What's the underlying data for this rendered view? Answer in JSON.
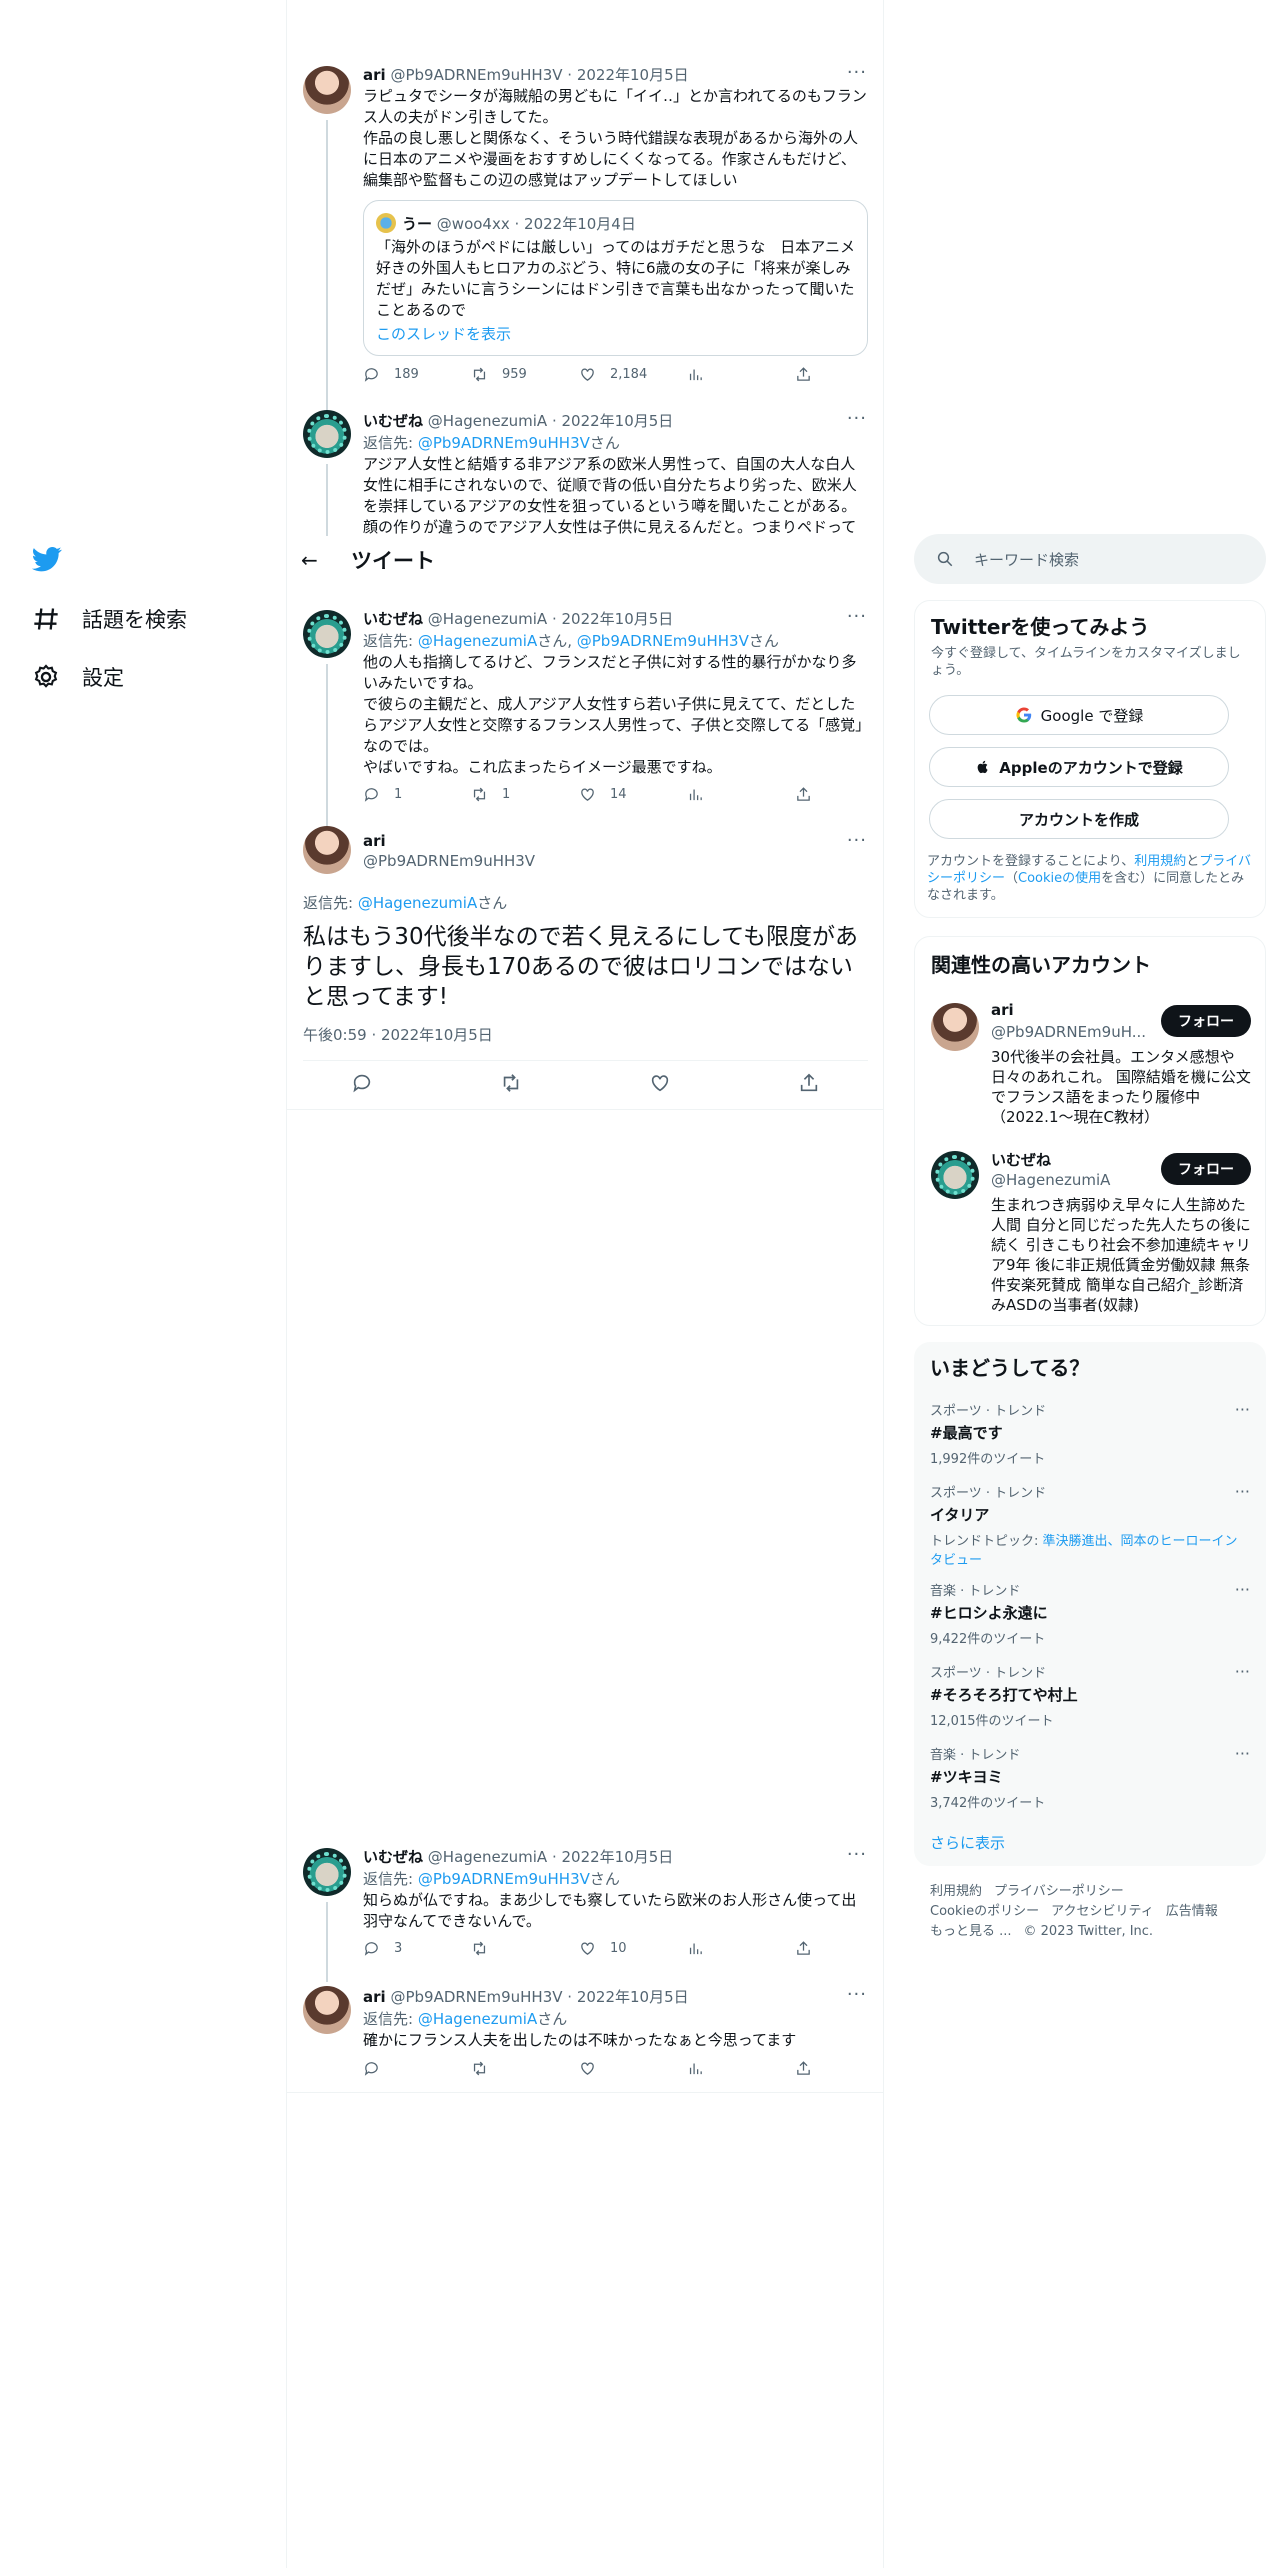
{
  "nav": {
    "explore_label": "話題を検索",
    "settings_label": "設定"
  },
  "header": {
    "back_arrow": "←",
    "title": "ツイート"
  },
  "tweets": {
    "t1": {
      "name": "ari",
      "handle_date": "@Pb9ADRNEm9uHH3V · 2022年10月5日",
      "text": "ラピュタでシータが海賊船の男どもに「イイ‥」とか言われてるのもフランス人の夫がドン引きしてた。\n作品の良し悪しと関係なく、そういう時代錯誤な表現があるから海外の人に日本のアニメや漫画をおすすめしにくくなってる。作家さんもだけど、編集部や監督もこの辺の感覚はアップデートしてほしい",
      "quote": {
        "name": "うー",
        "handle_date": "@woo4xx · 2022年10月4日",
        "text": "「海外のほうがペドには厳しい」ってのはガチだと思うな　日本アニメ好きの外国人もヒロアカのぶどう、特に6歳の女の子に「将来が楽しみだぜ」みたいに言うシーンにはドン引きで言葉も出なかったって聞いたことあるので",
        "show_thread": "このスレッドを表示"
      },
      "replies": "189",
      "retweets": "959",
      "likes": "2,184"
    },
    "t2": {
      "name": "いむぜね",
      "handle_date": "@HagenezumiA · 2022年10月5日",
      "reply_prefix": "返信先: ",
      "reply_link": "@Pb9ADRNEm9uHH3V",
      "reply_suffix": "さん",
      "text": "アジア人女性と結婚する非アジア系の欧米人男性って、自国の大人な白人女性に相手にされないので、従順で背の低い自分たちより劣った、欧米人を崇拝しているアジアの女性を狙っているという噂を聞いたことがある。顔の作りが違うのでアジア人女性は子供に見えるんだと。つまりペドって"
    },
    "t3": {
      "name": "いむぜね",
      "handle_date": "@HagenezumiA · 2022年10月5日",
      "reply_prefix": "返信先: ",
      "reply_link1": "@HagenezumiA",
      "reply_mid": "さん, ",
      "reply_link2": "@Pb9ADRNEm9uHH3V",
      "reply_suffix": "さん",
      "text": "他の人も指摘してるけど、フランスだと子供に対する性的暴行がかなり多いみたいですね。\nで彼らの主観だと、成人アジア人女性すら若い子供に見えてて、だとしたらアジア人女性と交際するフランス人男性って、子供と交際してる「感覚」なのでは。\nやばいですね。これ広まったらイメージ最悪ですね。",
      "replies": "1",
      "retweets": "1",
      "likes": "14"
    },
    "focus": {
      "name": "ari",
      "handle": "@Pb9ADRNEm9uHH3V",
      "reply_prefix": "返信先: ",
      "reply_link": "@HagenezumiA",
      "reply_suffix": "さん",
      "text": "私はもう30代後半なので若く見えるにしても限度がありますし、身長も170あるので彼はロリコンではないと思ってます!",
      "timestamp": "午後0:59 · 2022年10月5日"
    },
    "t5": {
      "name": "いむぜね",
      "handle_date": "@HagenezumiA · 2022年10月5日",
      "reply_prefix": "返信先: ",
      "reply_link": "@Pb9ADRNEm9uHH3V",
      "reply_suffix": "さん",
      "text": "知らぬが仏ですね。まあ少しでも察していたら欧米のお人形さん使って出羽守なんてできないんで。",
      "replies": "3",
      "likes": "10"
    },
    "t6": {
      "name": "ari",
      "handle_date": "@Pb9ADRNEm9uHH3V · 2022年10月5日",
      "reply_prefix": "返信先: ",
      "reply_link": "@HagenezumiA",
      "reply_suffix": "さん",
      "text": "確かにフランス人夫を出したのは不味かったなぁと今思ってます"
    }
  },
  "more_dots": "···",
  "search": {
    "placeholder": "キーワード検索"
  },
  "signup": {
    "title": "Twitterを使ってみよう",
    "subtitle": "今すぐ登録して、タイムラインをカスタマイズしましょう。",
    "google": "Google で登録",
    "apple": "Appleのアカウントで登録",
    "create": "アカウントを作成",
    "legal_1": "アカウントを登録することにより、",
    "legal_terms": "利用規約",
    "legal_2": "と",
    "legal_privacy": "プライバシーポリシー",
    "legal_3": "（",
    "legal_cookie": "Cookieの使用",
    "legal_4": "を含む）に同意したとみなされます。"
  },
  "relevant": {
    "title": "関連性の高いアカウント",
    "follow_label": "フォロー",
    "accounts": [
      {
        "name": "ari",
        "handle": "@Pb9ADRNEm9uH...",
        "bio": "30代後半の会社員。エンタメ感想や日々のあれこれ。 国際結婚を機に公文でフランス語をまったり履修中（2022.1〜現在C教材）"
      },
      {
        "name": "いむぜね",
        "handle": "@HagenezumiA",
        "bio": "生まれつき病弱ゆえ早々に人生諦めた人間 自分と同じだった先人たちの後に続く 引きこもり社会不参加連続キャリア9年 後に非正規低賃金労働奴隷 無条件安楽死賛成 簡単な自己紹介_診断済みASDの当事者(奴隷)"
      }
    ]
  },
  "trends": {
    "title": "いまどうしてる？",
    "items": [
      {
        "category": "スポーツ · トレンド",
        "name": "#最高です",
        "count": "1,992件のツイート"
      },
      {
        "category": "スポーツ · トレンド",
        "name": "イタリア",
        "topic_prefix": "トレンドトピック: ",
        "topic": "準決勝進出、岡本のヒーローインタビュー"
      },
      {
        "category": "音楽 · トレンド",
        "name": "#ヒロシよ永遠に",
        "count": "9,422件のツイート"
      },
      {
        "category": "スポーツ · トレンド",
        "name": "#そろそろ打てや村上",
        "count": "12,015件のツイート"
      },
      {
        "category": "音楽 · トレンド",
        "name": "#ツキヨミ",
        "count": "3,742件のツイート"
      }
    ],
    "show_more": "さらに表示"
  },
  "footer": {
    "terms": "利用規約",
    "privacy": "プライバシーポリシー",
    "cookie": "Cookieのポリシー",
    "accessibility": "アクセシビリティ",
    "ads": "広告情報",
    "more": "もっと見る ...",
    "copyright": "© 2023 Twitter, Inc."
  },
  "colors": {
    "accent": "#1d9bf0",
    "text": "#0f1419",
    "secondary": "#536471"
  }
}
